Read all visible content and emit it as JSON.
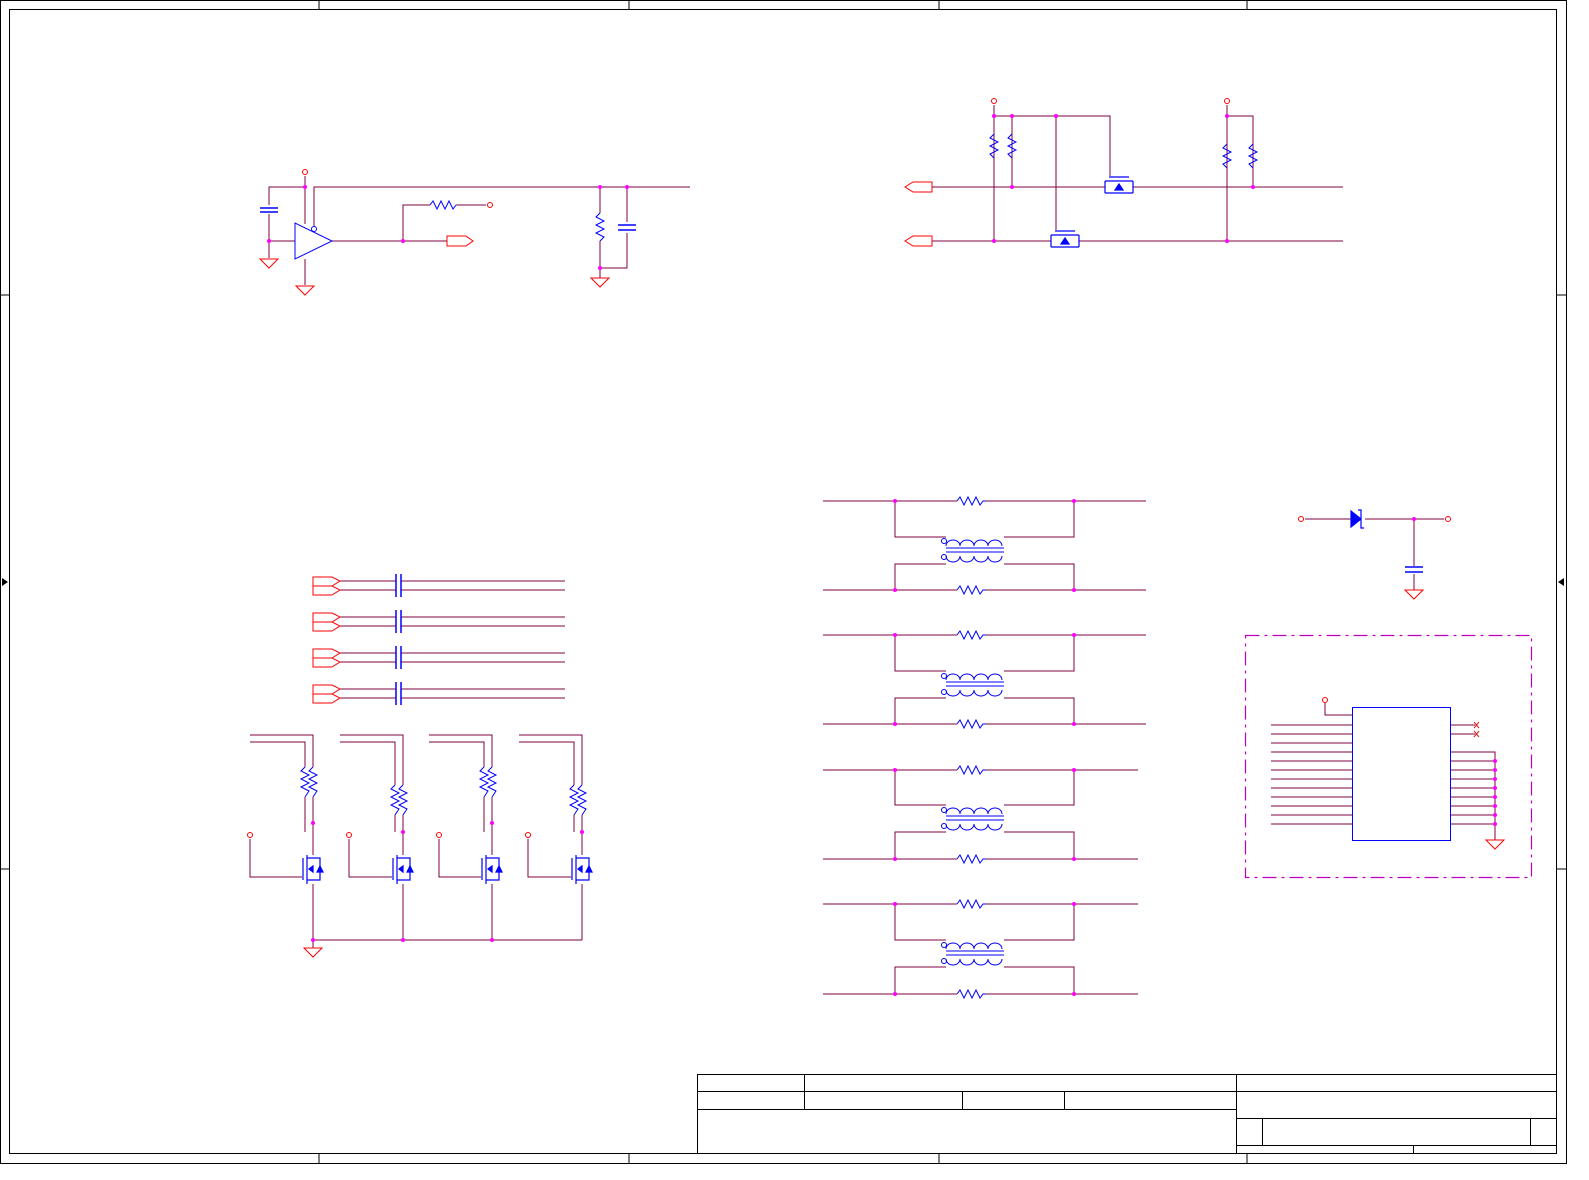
{
  "sheet": {
    "background": "#ffffff",
    "colors": {
      "wire": "#800040",
      "wire_alt": "#e02020",
      "pin": "#ff0000",
      "component": "#0000ff",
      "junction": "#ff00ff",
      "frame": "#000000",
      "dashed_box": "#c000c0"
    },
    "title_block": {
      "fields": []
    }
  },
  "blocks": [
    {
      "name": "comparator-circuit",
      "icons": [
        "opamp-icon",
        "resistor-icon",
        "capacitor-icon",
        "ground-icon",
        "power-port-icon",
        "offpage-connector-icon"
      ]
    },
    {
      "name": "level-shifter-circuit",
      "icons": [
        "mosfet-icon",
        "resistor-icon",
        "offpage-connector-icon",
        "power-port-icon"
      ]
    },
    {
      "name": "coupling-capacitor-array",
      "icons": [
        "capacitor-icon",
        "offpage-connector-icon"
      ]
    },
    {
      "name": "mosfet-switch-array",
      "icons": [
        "mosfet-icon",
        "resistor-icon",
        "power-port-icon",
        "ground-icon"
      ]
    },
    {
      "name": "common-mode-choke-array",
      "icons": [
        "common-mode-choke-icon",
        "resistor-icon"
      ]
    },
    {
      "name": "diode-capacitor-circuit",
      "icons": [
        "diode-icon",
        "capacitor-icon",
        "ground-icon",
        "power-port-icon"
      ]
    },
    {
      "name": "ic-connector-block",
      "icons": [
        "ic-package-icon",
        "no-connect-icon",
        "ground-icon",
        "power-port-icon"
      ]
    }
  ]
}
